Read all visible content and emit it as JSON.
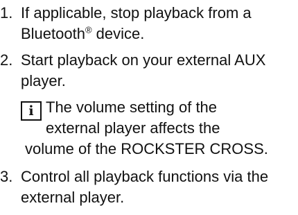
{
  "steps": [
    {
      "number": "1.",
      "text_before": "If applicable, stop playback from a Bluetooth",
      "reg_mark": "®",
      "text_after": " device."
    },
    {
      "number": "2.",
      "text": "Start playback on your external AUX player."
    },
    {
      "number": "3.",
      "text": "Control all playback functions via the external player."
    }
  ],
  "note": {
    "icon": "info-icon",
    "icon_glyph": "i",
    "line1": "The volume setting of the",
    "line2": "external player affects the",
    "line3": "volume of the ROCKSTER CROSS."
  }
}
